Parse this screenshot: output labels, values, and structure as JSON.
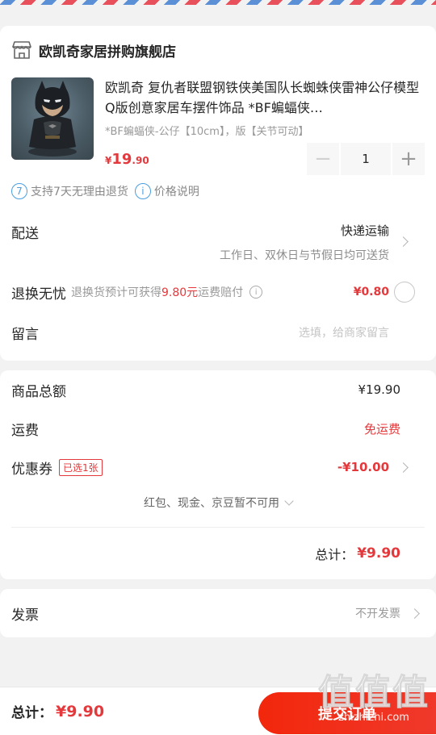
{
  "store": {
    "name": "欧凯奇家居拼购旗舰店"
  },
  "product": {
    "title": "欧凯奇 复仇者联盟钢铁侠美国队长蜘蛛侠雷神公仔模型Q版创意家居车摆件饰品 *BF蝙蝠侠…",
    "spec": "*BF蝙蝠侠-公仔【10cm】，版【关节可动】",
    "price_currency": "¥",
    "price_int": "19",
    "price_dec": ".90",
    "quantity": "1",
    "minus_glyph": "−",
    "plus_glyph": "+",
    "badge_return_icon": "7",
    "badge_return": "支持7天无理由退货",
    "badge_price_icon": "i",
    "badge_price": "价格说明"
  },
  "delivery": {
    "label": "配送",
    "method": "快递运输",
    "schedule": "工作日、双休日与节假日均可送货"
  },
  "return_service": {
    "label": "退换无忧",
    "desc_pre": "退换货预计可获得",
    "desc_amount": "9.80元",
    "desc_post": "运费赔付",
    "info_icon": "i",
    "price": "¥0.80"
  },
  "message": {
    "label": "留言",
    "placeholder": "选填，给商家留言"
  },
  "summary": {
    "goods_label": "商品总额",
    "goods_value": "¥19.90",
    "shipping_label": "运费",
    "shipping_value": "免运费",
    "coupon_label": "优惠券",
    "coupon_tag": "已选1张",
    "coupon_value": "-¥10.00",
    "unavailable": "红包、现金、京豆暂不可用",
    "total_label": "总计：",
    "total_value": "¥9.90"
  },
  "invoice": {
    "label": "发票",
    "value": "不开发票"
  },
  "bottom": {
    "total_label": "总计：",
    "total_value": "¥9.90",
    "submit_label": "提交订单"
  },
  "watermark": {
    "big": "值值值",
    "small": "zhizhizhi.com"
  },
  "colors": {
    "accent": "#e4393c",
    "link_blue": "#4a9fe0"
  }
}
